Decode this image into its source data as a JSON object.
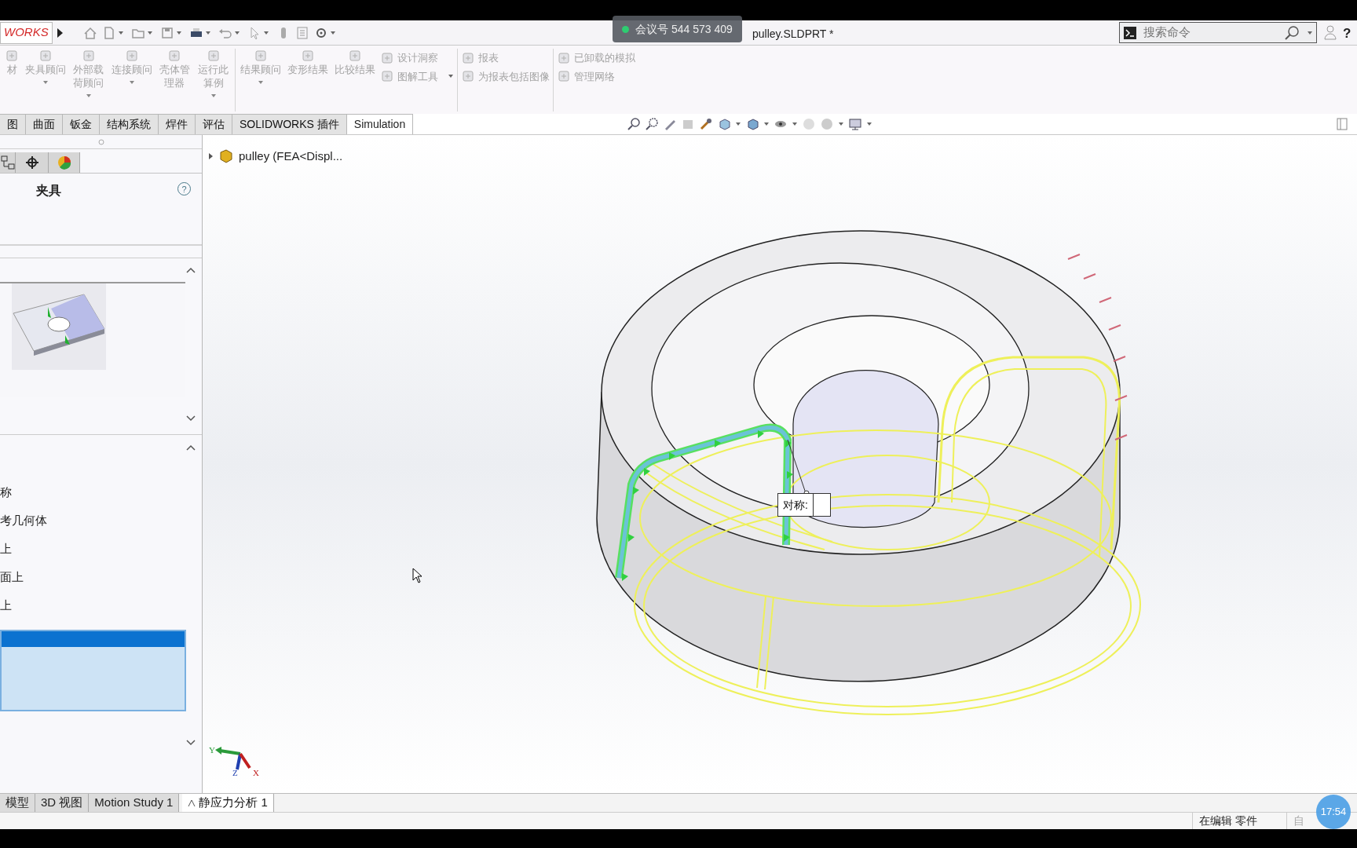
{
  "app_logo": "WORKS",
  "meeting_badge": "会议号 544 573 409",
  "window_title": "pulley.SLDPRT *",
  "search": {
    "placeholder": "搜索命令"
  },
  "help_button": "?",
  "ribbon": [
    [
      {
        "kind": "large",
        "label": "材",
        "disabled": true,
        "dropdown": false
      },
      {
        "kind": "large",
        "label": "夹具顾问",
        "disabled": true,
        "dropdown": true
      },
      {
        "kind": "large",
        "label": "外部载荷顾问",
        "disabled": true,
        "dropdown": true
      },
      {
        "kind": "large",
        "label": "连接顾问",
        "disabled": true,
        "dropdown": true
      },
      {
        "kind": "large",
        "label": "壳体管理器",
        "disabled": true,
        "dropdown": false
      },
      {
        "kind": "large",
        "label": "运行此算例",
        "disabled": true,
        "dropdown": true
      }
    ],
    [
      {
        "kind": "large",
        "label": "结果顾问",
        "disabled": true,
        "dropdown": true
      },
      {
        "kind": "large",
        "label": "变形结果",
        "disabled": true,
        "dropdown": false
      },
      {
        "kind": "large",
        "label": "比较结果",
        "disabled": true,
        "dropdown": false
      },
      {
        "kind": "small",
        "label": "设计洞察",
        "disabled": true,
        "dropdown": false
      },
      {
        "kind": "small",
        "label": "图解工具",
        "disabled": true,
        "dropdown": true
      }
    ],
    [
      {
        "kind": "small",
        "label": "报表",
        "disabled": true,
        "dropdown": false
      },
      {
        "kind": "small",
        "label": "为报表包括图像",
        "disabled": true,
        "dropdown": false
      }
    ],
    [
      {
        "kind": "small",
        "label": "已卸载的模拟",
        "disabled": true,
        "dropdown": false
      },
      {
        "kind": "small",
        "label": "管理网络",
        "disabled": true,
        "dropdown": false
      }
    ]
  ],
  "tabs": [
    {
      "label": "图",
      "selected": false
    },
    {
      "label": "曲面",
      "selected": false
    },
    {
      "label": "钣金",
      "selected": false
    },
    {
      "label": "结构系统",
      "selected": false
    },
    {
      "label": "焊件",
      "selected": false
    },
    {
      "label": "评估",
      "selected": false
    },
    {
      "label": "SOLIDWORKS 插件",
      "selected": false
    },
    {
      "label": "Simulation",
      "selected": true
    }
  ],
  "tree": {
    "label": "pulley (FEA<Displ...",
    "expanded": false
  },
  "panel": {
    "tabs": [
      {
        "selected": false
      },
      {
        "selected": false
      },
      {
        "selected": false
      }
    ],
    "title": "夹具",
    "help": "?",
    "list_items": [
      "称",
      "考几何体",
      "上",
      "面上",
      "上"
    ],
    "selection_list": [
      {
        "selected": true
      }
    ]
  },
  "callout": "对称:",
  "triad": [
    "Y",
    "Z",
    "X"
  ],
  "bottom_tabs": [
    {
      "label": "模型",
      "selected": false
    },
    {
      "label": "3D 视图",
      "selected": false
    },
    {
      "label": "Motion Study 1",
      "selected": false
    },
    {
      "label": "静应力分析 1",
      "selected": true
    }
  ],
  "status_bar": [
    "在编辑 零件",
    "自"
  ],
  "clock": "17:54"
}
